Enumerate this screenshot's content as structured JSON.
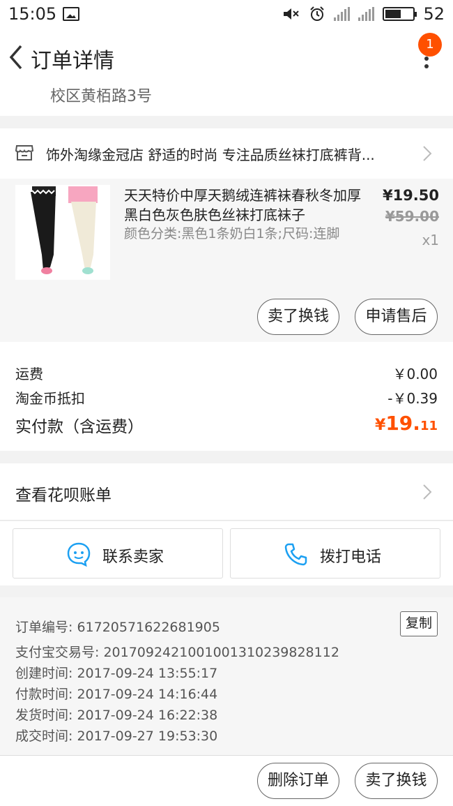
{
  "status_bar": {
    "time": "15:05",
    "battery": "52"
  },
  "header": {
    "title": "订单详情",
    "badge_count": "1"
  },
  "address": {
    "partial": "校区黄栢路3号"
  },
  "shop": {
    "name": "饰外淘缘金冠店 舒适的时尚 专注品质丝袜打底裤背..."
  },
  "product": {
    "title": "天天特价中厚天鹅绒连裤袜春秋冬加厚黑白色灰色肤色丝袜打底袜子",
    "sku": "颜色分类:黑色1条奶白1条;尺码:连脚",
    "price": "¥19.50",
    "original_price": "¥59.00",
    "quantity": "x1",
    "actions": [
      "卖了换钱",
      "申请售后"
    ]
  },
  "costs": {
    "shipping_label": "运费",
    "shipping_value": "￥0.00",
    "coin_label": "淘金币抵扣",
    "coin_value": "-￥0.39",
    "paid_label": "实付款（含运费）",
    "paid_currency": "¥",
    "paid_integer": "19.",
    "paid_decimal": "11"
  },
  "huabei": {
    "label": "查看花呗账单"
  },
  "contact": {
    "seller_label": "联系卖家",
    "phone_label": "拨打电话"
  },
  "order_info": {
    "order_no": "订单编号: 61720571622681905",
    "alipay_no": "支付宝交易号: 2017092421001001310239828112",
    "created": "创建时间: 2017-09-24 13:55:17",
    "paid": "付款时间: 2017-09-24 14:16:44",
    "shipped": "发货时间: 2017-09-24 16:22:38",
    "completed": "成交时间: 2017-09-27 19:53:30",
    "copy_label": "复制"
  },
  "bottom": {
    "delete_label": "删除订单",
    "sell_label": "卖了换钱"
  },
  "colors": {
    "accent": "#ff5000",
    "icon_blue": "#1ca0f2"
  }
}
